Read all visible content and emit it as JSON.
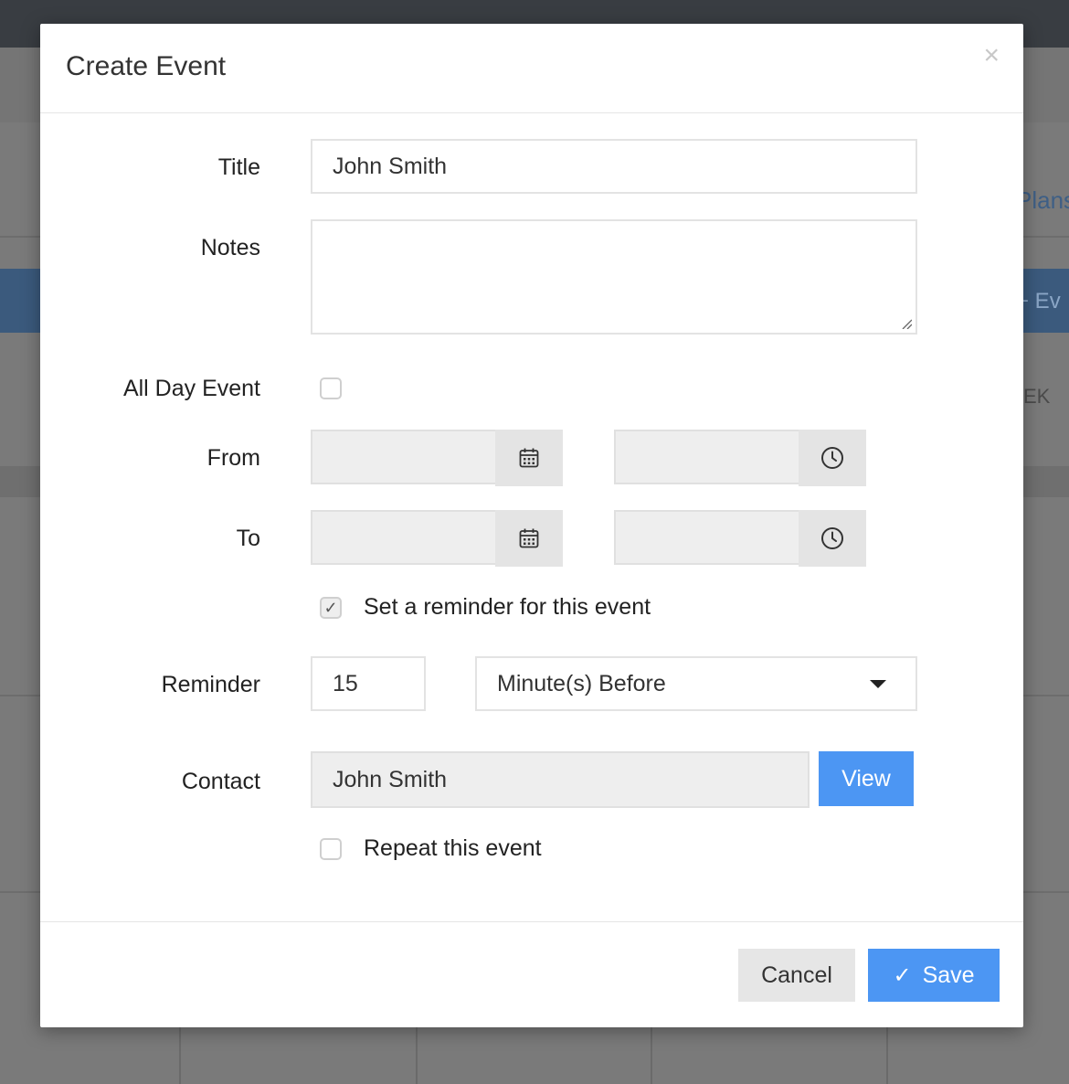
{
  "background": {
    "plans_text": "Plans",
    "event_btn_text": "+ Ev",
    "week_text": "EK"
  },
  "modal": {
    "title": "Create Event",
    "close_glyph": "×",
    "fields": {
      "title_label": "Title",
      "title_value": "John Smith",
      "notes_label": "Notes",
      "notes_value": "",
      "all_day_label": "All Day Event",
      "all_day_checked": false,
      "from_label": "From",
      "from_date": "",
      "from_time": "",
      "to_label": "To",
      "to_date": "",
      "to_time": "",
      "reminder_toggle_label": "Set a reminder for this event",
      "reminder_toggle_checked": true,
      "reminder_label": "Reminder",
      "reminder_value": "15",
      "reminder_unit": "Minute(s) Before",
      "contact_label": "Contact",
      "contact_value": "John Smith",
      "view_label": "View",
      "repeat_label": "Repeat this event",
      "repeat_checked": false
    },
    "footer": {
      "cancel_label": "Cancel",
      "save_label": "Save",
      "save_icon": "✓"
    }
  },
  "icons": {
    "calendar": "calendar-icon",
    "clock": "clock-icon",
    "caret": "caret-down-icon",
    "check": "check-icon",
    "close": "close-icon"
  },
  "colors": {
    "primary": "#4c96f3",
    "overlay": "#7a7a7a",
    "topbar": "#393d42"
  }
}
